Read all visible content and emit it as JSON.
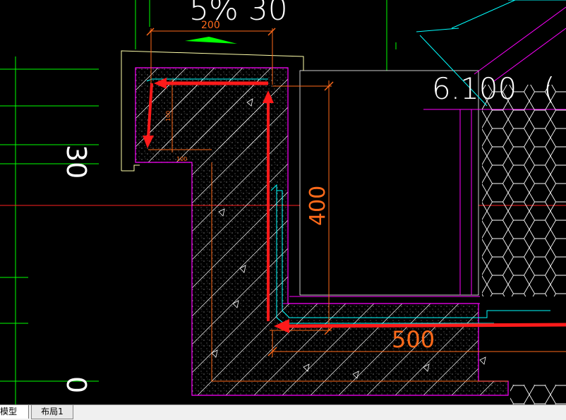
{
  "drawing": {
    "slope_text": "5% 30",
    "elevation_text": "6.100",
    "elevation_suffix": "(",
    "dim_top": "200",
    "dim_right_vertical": "400",
    "dim_bottom": "500",
    "dim_small_vertical": "100",
    "dim_small_horizontal": "100",
    "left_label_1": "30",
    "left_label_2": "0"
  },
  "tabs": {
    "model": "模型",
    "layout1": "布局1"
  },
  "colors": {
    "background": "#000000",
    "green_lines": "#00ff00",
    "red_lines": "#ff2a2a",
    "magenta": "#ff00ff",
    "cyan": "#00ffff",
    "orange_dims": "#ff6a1a",
    "white_text": "#ffffff",
    "arrow_red": "#ff1a1a"
  }
}
